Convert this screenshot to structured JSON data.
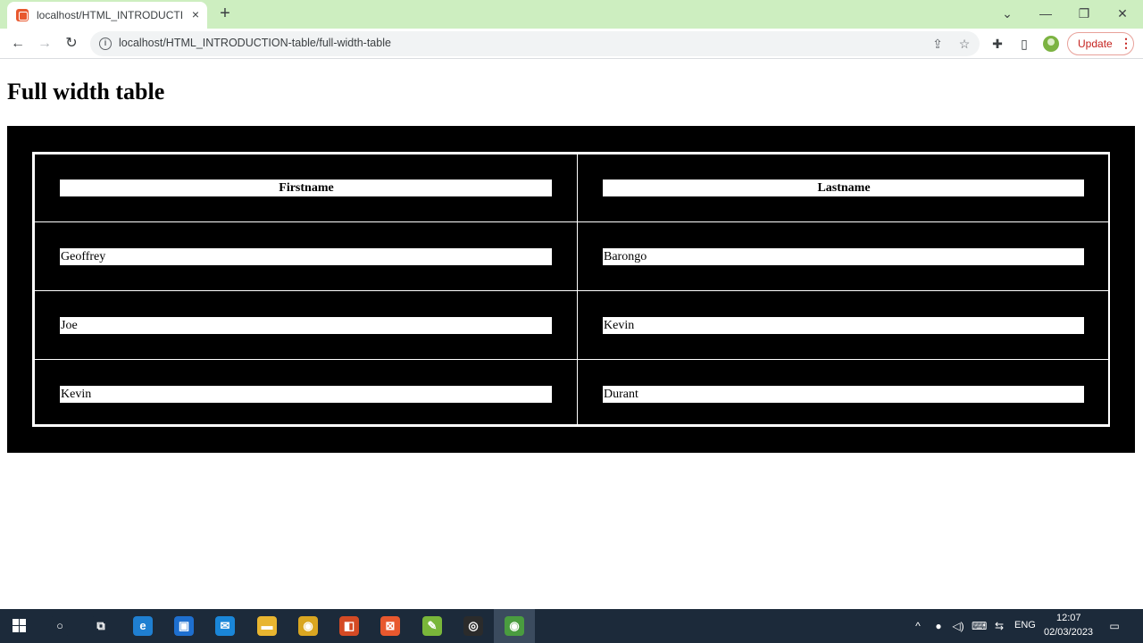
{
  "browser": {
    "tab": {
      "title": "localhost/HTML_INTRODUCTION",
      "close": "×"
    },
    "new_tab": "+",
    "window_controls": {
      "dropdown": "⌄",
      "minimize": "—",
      "restore": "❐",
      "close": "✕"
    },
    "nav": {
      "back": "←",
      "forward": "→",
      "reload": "↻"
    },
    "address": {
      "info": "i",
      "url": "localhost/HTML_INTRODUCTION-table/full-width-table"
    },
    "omnibox_icons": {
      "share": "⇪",
      "bookmark": "☆"
    },
    "toolbar_icons": {
      "extensions": "✚",
      "sidebar": "▯"
    },
    "update": {
      "label": "Update",
      "menu": "⋮"
    }
  },
  "page": {
    "title": "Full width table",
    "table": {
      "headers": [
        "Firstname",
        "Lastname"
      ],
      "rows": [
        [
          "Geoffrey",
          "Barongo"
        ],
        [
          "Joe",
          "Kevin"
        ],
        [
          "Kevin",
          "Durant"
        ]
      ]
    }
  },
  "taskbar": {
    "apps": [
      {
        "name": "search",
        "icon": "search-circle-icon",
        "glyph": "○",
        "color": "#1c2a3a"
      },
      {
        "name": "task-view",
        "icon": "task-view-icon",
        "glyph": "⧉",
        "color": "#1c2a3a"
      },
      {
        "name": "edge",
        "icon": "edge-icon",
        "glyph": "e",
        "color": "#1f7fd1"
      },
      {
        "name": "store",
        "icon": "store-icon",
        "glyph": "▣",
        "color": "#1e6fcf"
      },
      {
        "name": "mail",
        "icon": "mail-icon",
        "glyph": "✉",
        "color": "#1a86d8"
      },
      {
        "name": "file-explorer",
        "icon": "folder-icon",
        "glyph": "▬",
        "color": "#e8b530"
      },
      {
        "name": "chrome",
        "icon": "chrome-icon",
        "glyph": "◉",
        "color": "#d9a621"
      },
      {
        "name": "office",
        "icon": "office-icon",
        "glyph": "◧",
        "color": "#d44a24"
      },
      {
        "name": "xampp",
        "icon": "xampp-icon",
        "glyph": "⊠",
        "color": "#e8582e"
      },
      {
        "name": "notepad-plus",
        "icon": "notepad-icon",
        "glyph": "✎",
        "color": "#79b63a"
      },
      {
        "name": "obs",
        "icon": "recorder-icon",
        "glyph": "◎",
        "color": "#2b2b2b"
      },
      {
        "name": "chrome-active",
        "icon": "chrome-icon",
        "glyph": "◉",
        "color": "#4a9c3f"
      }
    ],
    "tray": {
      "language": "ENG",
      "time": "12:07",
      "date": "02/03/2023"
    }
  }
}
